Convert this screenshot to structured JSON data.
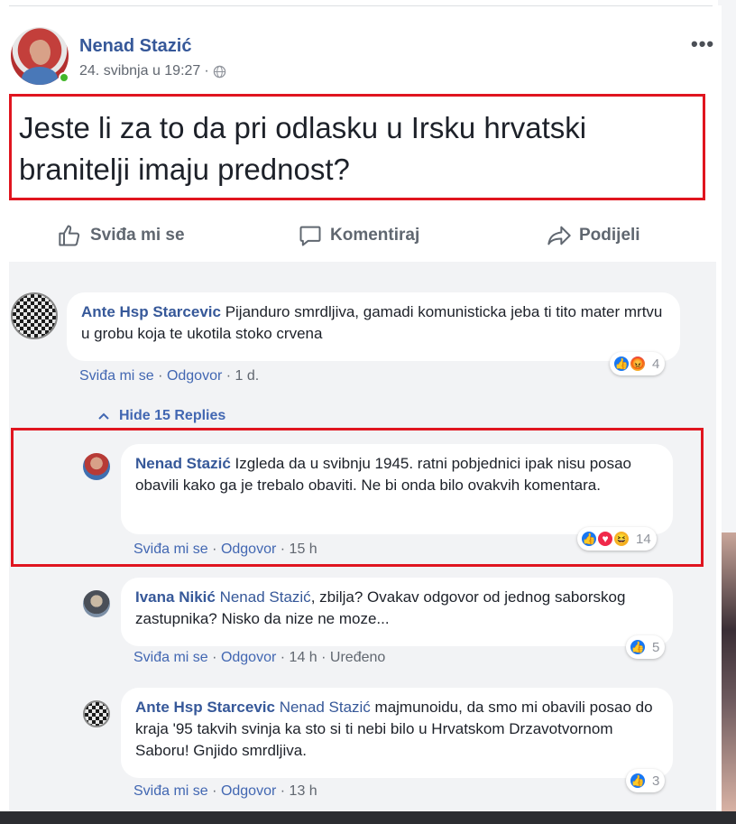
{
  "post": {
    "author": "Nenad Stazić",
    "timestamp": "24. svibnja u 19:27",
    "separator": "·",
    "privacy_icon": "globe-icon",
    "more_label": "•••",
    "text": "Jeste li za to da pri odlasku u Irsku hrvatski branitelji imaju prednost?"
  },
  "actions": {
    "like": "Sviđa mi se",
    "comment": "Komentiraj",
    "share": "Podijeli"
  },
  "comments": [
    {
      "author": "Ante Hsp Starcevic",
      "text": "Pijanduro smrdljiva, gamadi komunisticka jeba ti tito mater mrtvu u grobu koja te ukotila stoko crvena",
      "like_label": "Sviđa mi se",
      "reply_label": "Odgovor",
      "time": "1 d.",
      "reactions": [
        "like-icon",
        "angry-icon"
      ],
      "reaction_count": "4"
    }
  ],
  "hide_replies": "Hide 15 Replies",
  "replies": [
    {
      "author": "Nenad Stazić",
      "mention": "",
      "text": "Izgleda da u svibnju 1945. ratni pobjednici ipak nisu posao obavili kako ga je trebalo obaviti. Ne bi onda bilo ovakvih komentara.",
      "like_label": "Sviđa mi se",
      "reply_label": "Odgovor",
      "time": "15 h",
      "edited": "",
      "reactions": [
        "like-icon",
        "love-icon",
        "haha-icon"
      ],
      "reaction_count": "14"
    },
    {
      "author": "Ivana Nikić",
      "mention": "Nenad Stazić",
      "text": ", zbilja? Ovakav odgovor od jednog saborskog zastupnika? Nisko da nize ne moze...",
      "like_label": "Sviđa mi se",
      "reply_label": "Odgovor",
      "time": "14 h",
      "edited": "Uređeno",
      "reactions": [
        "like-icon"
      ],
      "reaction_count": "5"
    },
    {
      "author": "Ante Hsp Starcevic",
      "mention": "Nenad Stazić",
      "text": " majmunoidu, da smo mi obavili posao do kraja '95 takvih svinja ka sto si ti nebi bilo u Hrvatskom Drzavotvornom Saboru! Gnjido smrdljiva.",
      "like_label": "Sviđa mi se",
      "reply_label": "Odgovor",
      "time": "13 h",
      "edited": "",
      "reactions": [
        "like-icon"
      ],
      "reaction_count": "3"
    }
  ],
  "colors": {
    "link_blue": "#365899",
    "highlight_red": "#e0151f",
    "panel_bg": "#f2f3f5"
  }
}
